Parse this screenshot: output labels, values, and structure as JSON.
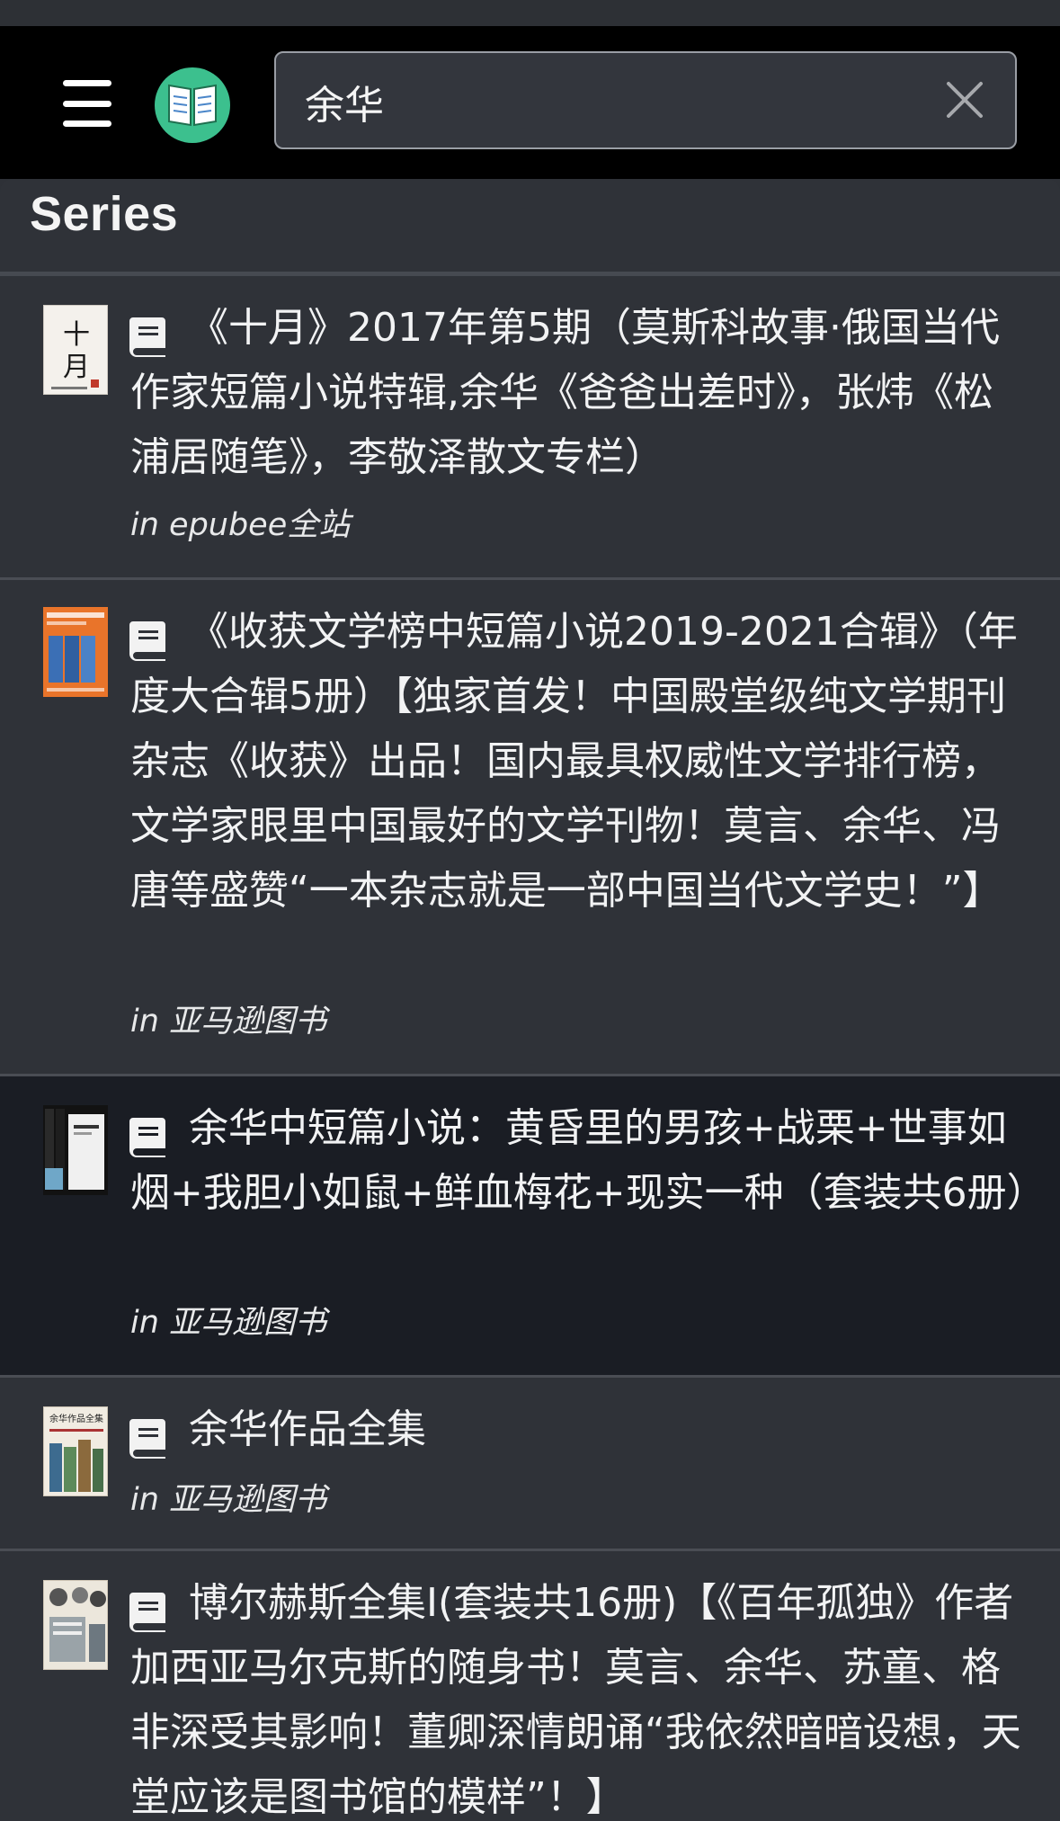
{
  "header": {
    "search_value": "余华",
    "menu_icon": "hamburger-menu-icon",
    "logo_icon": "open-book-logo",
    "clear_icon": "close-icon",
    "logo_color": "#3cc08e"
  },
  "section": {
    "title": "Series"
  },
  "results": [
    {
      "title": "《十月》2017年第5期（莫斯科故事·俄国当代作家短篇小说特辑,余华《爸爸出差时》，张炜《松浦居随笔》，李敬泽散文专栏）",
      "source": "in epubee全站",
      "icon": "book-icon"
    },
    {
      "title": "《收获文学榜中短篇小说2019-2021合辑》（年度大合辑5册）【独家首发！中国殿堂级纯文学期刊杂志《收获》出品！国内最具权威性文学排行榜，文学家眼里中国最好的文学刊物！莫言、余华、冯唐等盛赞“一本杂志就是一部中国当代文学史！”】",
      "source": "in 亚马逊图书",
      "icon": "book-icon"
    },
    {
      "title": "余华中短篇小说：黄昏里的男孩+战栗+世事如烟+我胆小如鼠+鲜血梅花+现实一种（套装共6册）",
      "source": "in 亚马逊图书",
      "icon": "book-icon",
      "selected": true
    },
    {
      "title": "余华作品全集",
      "source": "in 亚马逊图书",
      "icon": "book-icon"
    },
    {
      "title": "博尔赫斯全集I(套装共16册)【《百年孤独》作者加西亚马尔克斯的随身书！莫言、余华、苏童、格非深受其影响！董卿深情朗诵“我依然暗暗设想，天堂应该是图书馆的模样”！】",
      "source": "",
      "icon": "book-icon"
    }
  ]
}
